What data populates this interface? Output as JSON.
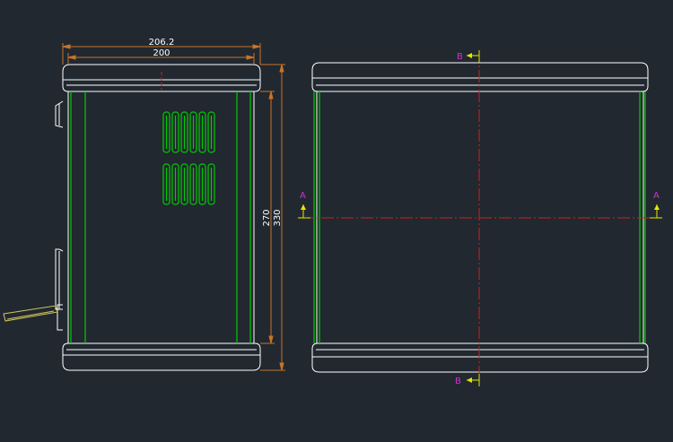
{
  "dimensions": {
    "width_outer": "206.2",
    "width_inner": "200",
    "height_inner": "270",
    "height_outer": "330"
  },
  "section_labels": {
    "top_b": "B",
    "bottom_b": "B",
    "left_a": "A",
    "right_a": "A"
  },
  "colors": {
    "background": "#212830",
    "outline": "#ffffff",
    "side_lines": "#00cc00",
    "vents": "#00cc00",
    "dimension": "#c87428",
    "centerline": "#cc2222",
    "label": "#cc33cc",
    "arrow": "#e8e800",
    "handle": "#d4c85a"
  }
}
